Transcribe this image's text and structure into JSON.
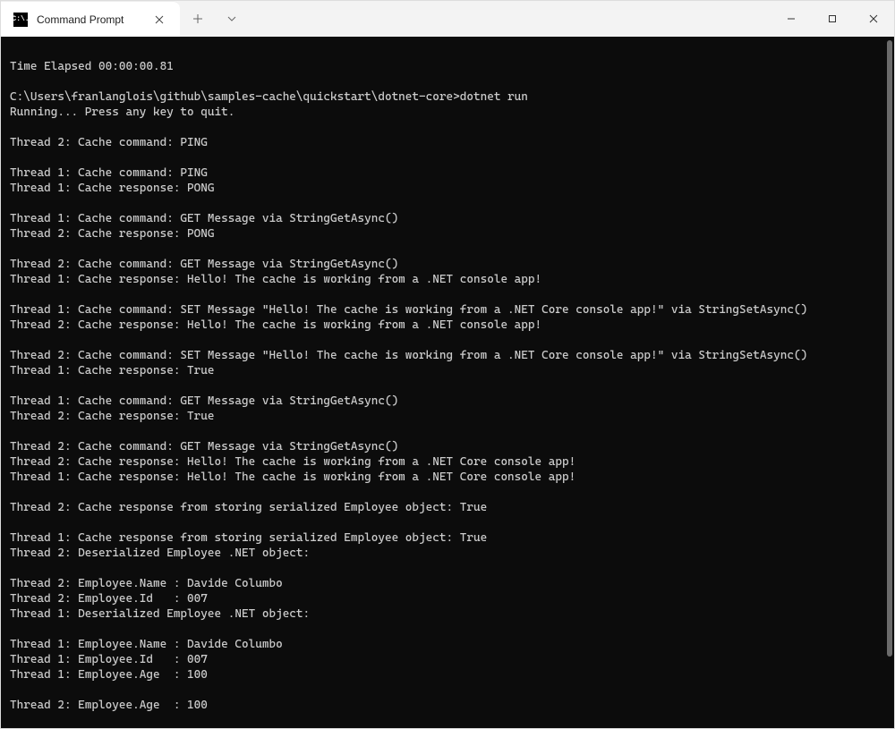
{
  "tab": {
    "icon_text": "C:\\.",
    "title": "Command Prompt"
  },
  "terminal_lines": [
    "",
    "Time Elapsed 00:00:00.81",
    "",
    "C:\\Users\\franlanglois\\github\\samples-cache\\quickstart\\dotnet-core>dotnet run",
    "Running... Press any key to quit.",
    "",
    "Thread 2: Cache command: PING",
    "",
    "Thread 1: Cache command: PING",
    "Thread 1: Cache response: PONG",
    "",
    "Thread 1: Cache command: GET Message via StringGetAsync()",
    "Thread 2: Cache response: PONG",
    "",
    "Thread 2: Cache command: GET Message via StringGetAsync()",
    "Thread 1: Cache response: Hello! The cache is working from a .NET console app!",
    "",
    "Thread 1: Cache command: SET Message \"Hello! The cache is working from a .NET Core console app!\" via StringSetAsync()",
    "Thread 2: Cache response: Hello! The cache is working from a .NET console app!",
    "",
    "Thread 2: Cache command: SET Message \"Hello! The cache is working from a .NET Core console app!\" via StringSetAsync()",
    "Thread 1: Cache response: True",
    "",
    "Thread 1: Cache command: GET Message via StringGetAsync()",
    "Thread 2: Cache response: True",
    "",
    "Thread 2: Cache command: GET Message via StringGetAsync()",
    "Thread 2: Cache response: Hello! The cache is working from a .NET Core console app!",
    "Thread 1: Cache response: Hello! The cache is working from a .NET Core console app!",
    "",
    "Thread 2: Cache response from storing serialized Employee object: True",
    "",
    "Thread 1: Cache response from storing serialized Employee object: True",
    "Thread 2: Deserialized Employee .NET object:",
    "",
    "Thread 2: Employee.Name : Davide Columbo",
    "Thread 2: Employee.Id   : 007",
    "Thread 1: Deserialized Employee .NET object:",
    "",
    "Thread 1: Employee.Name : Davide Columbo",
    "Thread 1: Employee.Id   : 007",
    "Thread 1: Employee.Age  : 100",
    "",
    "Thread 2: Employee.Age  : 100"
  ]
}
